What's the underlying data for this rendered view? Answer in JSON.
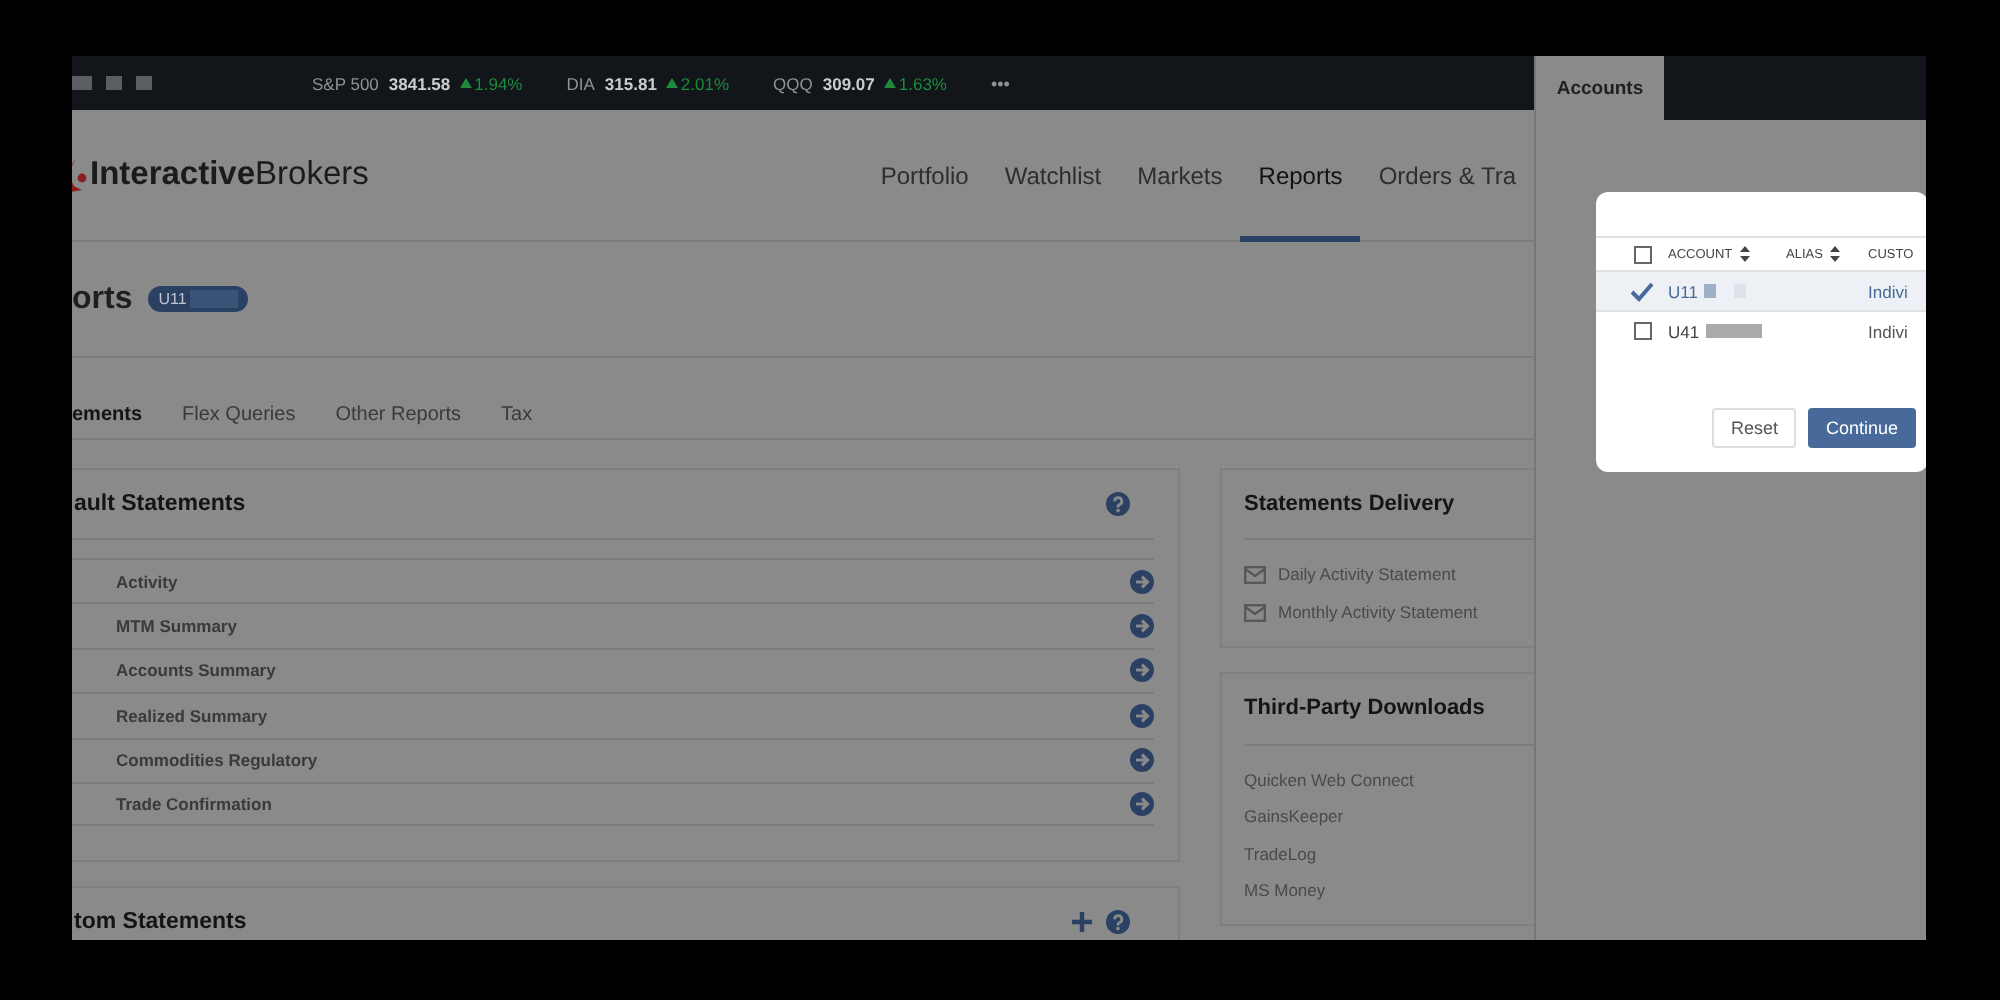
{
  "ticker": {
    "items": [
      {
        "symbol": "S&P 500",
        "price": "3841.58",
        "change": "1.94%"
      },
      {
        "symbol": "DIA",
        "price": "315.81",
        "change": "2.01%"
      },
      {
        "symbol": "QQQ",
        "price": "309.07",
        "change": "1.63%"
      }
    ],
    "more": "•••"
  },
  "header": {
    "logo": {
      "brand_bold": "Interactive",
      "brand_light": "Brokers"
    },
    "nav": [
      {
        "label": "Portfolio",
        "selected": false
      },
      {
        "label": "Watchlist",
        "selected": false
      },
      {
        "label": "Markets",
        "selected": false
      },
      {
        "label": "Reports",
        "selected": true
      },
      {
        "label": "Orders & Tra",
        "selected": false
      }
    ]
  },
  "page": {
    "title": "orts",
    "account_badge": "U11"
  },
  "tabs": [
    {
      "label": "ements",
      "selected": true
    },
    {
      "label": "Flex Queries",
      "selected": false
    },
    {
      "label": "Other Reports",
      "selected": false
    },
    {
      "label": "Tax",
      "selected": false
    }
  ],
  "default_statements": {
    "title": "ault Statements",
    "items": [
      "Activity",
      "MTM Summary",
      "Accounts Summary",
      "Realized Summary",
      "Commodities Regulatory",
      "Trade Confirmation"
    ]
  },
  "custom_statements": {
    "title": "tom Statements"
  },
  "statements_delivery": {
    "title": "Statements Delivery",
    "items": [
      "Daily Activity Statement",
      "Monthly Activity Statement"
    ]
  },
  "third_party_downloads": {
    "title": "Third-Party Downloads",
    "items": [
      "Quicken Web Connect",
      "GainsKeeper",
      "TradeLog",
      "MS Money"
    ]
  },
  "accounts_panel": {
    "tab": "Accounts",
    "dialog": {
      "select_all_checked": false,
      "columns": [
        {
          "label": "ACCOUNT",
          "sortable": true
        },
        {
          "label": "ALIAS",
          "sortable": true
        },
        {
          "label": "CUSTO",
          "sortable": false
        }
      ],
      "rows": [
        {
          "account": "U11",
          "type": "Indivi",
          "selected": true
        },
        {
          "account": "U41",
          "type": "Indivi",
          "selected": false
        }
      ],
      "buttons": [
        {
          "label": "Reset",
          "kind": "secondary"
        },
        {
          "label": "Continue",
          "kind": "primary"
        }
      ]
    }
  }
}
